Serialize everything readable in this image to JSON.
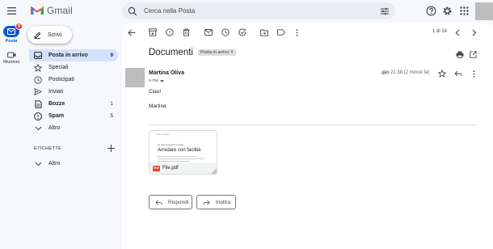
{
  "app": {
    "name": "Gmail"
  },
  "search": {
    "placeholder": "Cerca nella Posta"
  },
  "rail": {
    "mail": {
      "label": "Posta",
      "badge": "9"
    },
    "meet": {
      "label": "Riunioni"
    }
  },
  "compose": {
    "label": "Scrivi"
  },
  "nav": {
    "items": [
      {
        "label": "Posta in arrivo",
        "count": "9",
        "icon": "inbox-icon"
      },
      {
        "label": "Speciali",
        "count": "",
        "icon": "star-icon"
      },
      {
        "label": "Posticipati",
        "count": "",
        "icon": "clock-icon"
      },
      {
        "label": "Inviati",
        "count": "",
        "icon": "send-icon"
      },
      {
        "label": "Bozze",
        "count": "1",
        "icon": "draft-icon"
      },
      {
        "label": "Spam",
        "count": "5",
        "icon": "spam-icon"
      },
      {
        "label": "Altro",
        "count": "",
        "icon": "chevron-down-icon"
      }
    ],
    "labels_title": "ETICHETTE",
    "labels_more": "Altro"
  },
  "toolbar": {
    "pagination": "1 di 14"
  },
  "email": {
    "subject": "Documenti",
    "label_chip": "Posta in arrivo",
    "sender": "Martina Oliva",
    "recipient": "a me",
    "time": "21:38 (2 minuti fa)",
    "body": [
      "Ciao!",
      "Martina"
    ]
  },
  "attachment": {
    "thumb_small": "www.example.it",
    "thumb_kicker": "La vita semplice in casa",
    "thumb_title": "Arredare con facilità",
    "file_name": "File.pdf",
    "file_type": "PDF"
  },
  "actions": {
    "reply": "Rispondi",
    "forward": "Inoltra"
  },
  "colors": {
    "accent": "#0b57d0",
    "active_nav": "#d3e3fd",
    "badge": "#d93025",
    "background": "#f6f8fc"
  }
}
